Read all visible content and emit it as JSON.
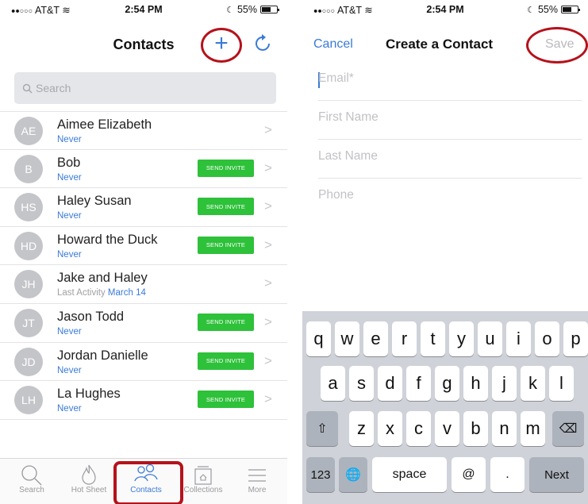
{
  "left_screen": {
    "status_bar": {
      "carrier": "AT&T",
      "time": "2:54 PM",
      "battery": "55%"
    },
    "title": "Contacts",
    "add_label": "+",
    "search_placeholder": "Search",
    "contacts": [
      {
        "initials": "AE",
        "name": "Aimee Elizabeth",
        "status": "Never",
        "invite": false
      },
      {
        "initials": "B",
        "name": "Bob",
        "status": "Never",
        "invite": true
      },
      {
        "initials": "HS",
        "name": "Haley Susan",
        "status": "Never",
        "invite": true
      },
      {
        "initials": "HD",
        "name": "Howard the Duck",
        "status": "Never",
        "invite": true
      },
      {
        "initials": "JH",
        "name": "Jake and Haley",
        "status_prefix": "Last Activity",
        "status": "March 14",
        "invite": false
      },
      {
        "initials": "JT",
        "name": "Jason Todd",
        "status": "Never",
        "invite": true
      },
      {
        "initials": "JD",
        "name": "Jordan  Danielle",
        "status": "Never",
        "invite": true
      },
      {
        "initials": "LH",
        "name": "La Hughes",
        "status": "Never",
        "invite": true
      }
    ],
    "invite_label": "SEND INVITE",
    "tabs": [
      {
        "label": "Search",
        "icon": "search-icon"
      },
      {
        "label": "Hot Sheet",
        "icon": "flame-icon"
      },
      {
        "label": "Contacts",
        "icon": "people-icon",
        "active": true
      },
      {
        "label": "Collections",
        "icon": "collection-icon"
      },
      {
        "label": "More",
        "icon": "menu-icon"
      }
    ],
    "annotation_color": "#b5121b",
    "accent_color": "#3a7bd5",
    "invite_color": "#2ec13a"
  },
  "right_screen": {
    "status_bar": {
      "carrier": "AT&T",
      "time": "2:54 PM",
      "battery": "55%"
    },
    "cancel_label": "Cancel",
    "title": "Create a Contact",
    "save_label": "Save",
    "fields": [
      {
        "placeholder": "Email*",
        "value": ""
      },
      {
        "placeholder": "First Name",
        "value": ""
      },
      {
        "placeholder": "Last Name",
        "value": ""
      },
      {
        "placeholder": "Phone",
        "value": ""
      }
    ],
    "keyboard": {
      "row1": [
        "q",
        "w",
        "e",
        "r",
        "t",
        "y",
        "u",
        "i",
        "o",
        "p"
      ],
      "row2": [
        "a",
        "s",
        "d",
        "f",
        "g",
        "h",
        "j",
        "k",
        "l"
      ],
      "row3": [
        "z",
        "x",
        "c",
        "v",
        "b",
        "n",
        "m"
      ],
      "shift": "⇧",
      "backspace": "⌫",
      "numbers": "123",
      "globe": "🌐",
      "space": "space",
      "at": "@",
      "period": ".",
      "next": "Next"
    }
  }
}
